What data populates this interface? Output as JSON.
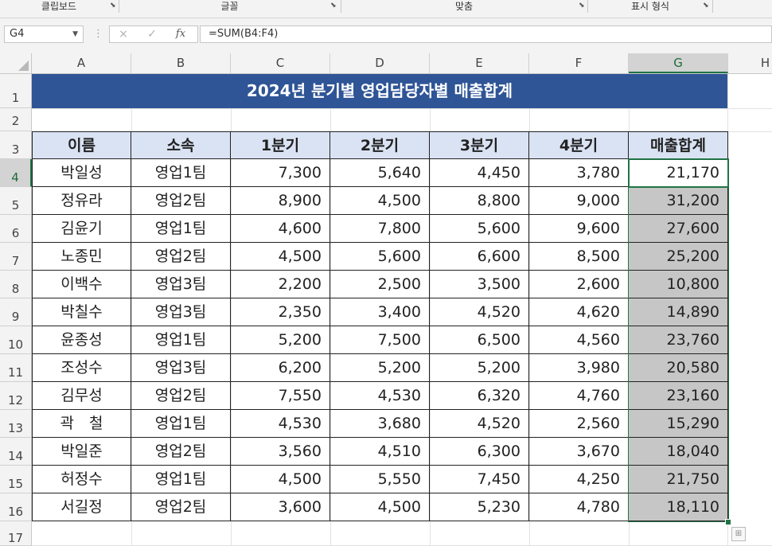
{
  "ribbon": {
    "groups": [
      "클립보드",
      "글꼴",
      "맞춤",
      "표시 형식"
    ],
    "launcher_icon": "dialog-launcher-icon"
  },
  "formula_bar": {
    "name_box": "G4",
    "cancel_icon": "×",
    "enter_icon": "✓",
    "fx_label": "fx",
    "formula": "=SUM(B4:F4)"
  },
  "columns": [
    "A",
    "B",
    "C",
    "D",
    "E",
    "F",
    "G",
    "H"
  ],
  "rows": [
    "1",
    "2",
    "3",
    "4",
    "5",
    "6",
    "7",
    "8",
    "9",
    "10",
    "11",
    "12",
    "13",
    "14",
    "15",
    "16",
    "17"
  ],
  "selected_cell": "G4",
  "sheet": {
    "title": "2024년 분기별 영업담당자별 매출합계",
    "headers": [
      "이름",
      "소속",
      "1분기",
      "2분기",
      "3분기",
      "4분기",
      "매출합계"
    ],
    "data": [
      [
        "박일성",
        "영업1팀",
        "7,300",
        "5,640",
        "4,450",
        "3,780",
        "21,170"
      ],
      [
        "정유라",
        "영업2팀",
        "8,900",
        "4,500",
        "8,800",
        "9,000",
        "31,200"
      ],
      [
        "김윤기",
        "영업1팀",
        "4,600",
        "7,800",
        "5,600",
        "9,600",
        "27,600"
      ],
      [
        "노종민",
        "영업2팀",
        "4,500",
        "5,600",
        "6,600",
        "8,500",
        "25,200"
      ],
      [
        "이백수",
        "영업3팀",
        "2,200",
        "2,500",
        "3,500",
        "2,600",
        "10,800"
      ],
      [
        "박칠수",
        "영업3팀",
        "2,350",
        "3,400",
        "4,520",
        "4,620",
        "14,890"
      ],
      [
        "윤종성",
        "영업1팀",
        "5,200",
        "7,500",
        "6,500",
        "4,560",
        "23,760"
      ],
      [
        "조성수",
        "영업3팀",
        "6,200",
        "5,200",
        "5,200",
        "3,980",
        "20,580"
      ],
      [
        "김무성",
        "영업2팀",
        "7,550",
        "4,530",
        "6,320",
        "4,760",
        "23,160"
      ],
      [
        "곽　철",
        "영업1팀",
        "4,530",
        "3,680",
        "4,520",
        "2,560",
        "15,290"
      ],
      [
        "박일준",
        "영업2팀",
        "3,560",
        "4,510",
        "6,300",
        "3,670",
        "18,040"
      ],
      [
        "허정수",
        "영업1팀",
        "4,500",
        "5,550",
        "7,450",
        "4,250",
        "21,750"
      ],
      [
        "서길정",
        "영업2팀",
        "3,600",
        "4,500",
        "5,230",
        "4,780",
        "18,110"
      ]
    ]
  },
  "colors": {
    "title_bg": "#2f5597",
    "header_bg": "#dae3f3",
    "sum_fill": "#c6c6c6",
    "selection": "#217346"
  }
}
